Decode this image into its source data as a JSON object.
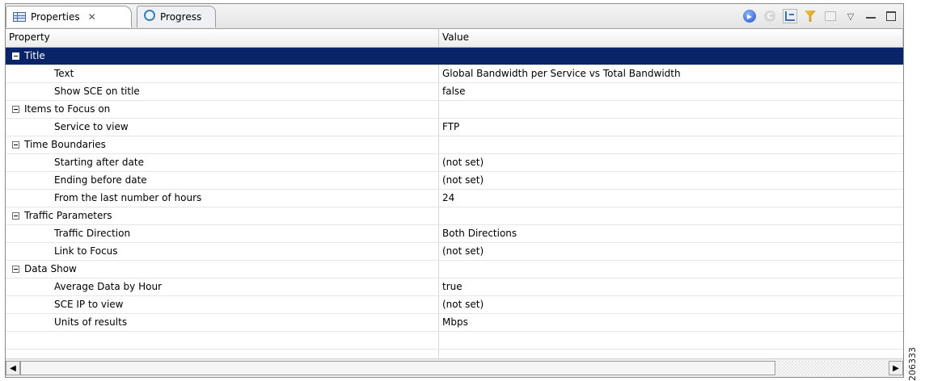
{
  "tabs": [
    {
      "label": "Properties",
      "icon": "properties-icon",
      "active": true,
      "close": "✕"
    },
    {
      "label": "Progress",
      "icon": "progress-icon",
      "active": false
    }
  ],
  "toolbar": {
    "icons": [
      "run-icon",
      "c-icon",
      "show-categories-icon",
      "filter-icon",
      "advanced-icon",
      "view-menu-icon",
      "minimize-icon",
      "maximize-icon"
    ],
    "menu_glyph": "▽",
    "c_glyph": "C"
  },
  "table": {
    "headers": {
      "property": "Property",
      "value": "Value"
    },
    "rows": [
      {
        "property": "Title",
        "value": "",
        "category": true,
        "selected": true
      },
      {
        "property": "Text",
        "value": "Global Bandwidth per Service vs Total Bandwidth"
      },
      {
        "property": "Show SCE on title",
        "value": "false"
      },
      {
        "property": "Items to Focus on",
        "value": "",
        "category": true
      },
      {
        "property": "Service to view",
        "value": "FTP"
      },
      {
        "property": "Time Boundaries",
        "value": "",
        "category": true
      },
      {
        "property": "Starting after date",
        "value": "(not set)"
      },
      {
        "property": "Ending before date",
        "value": "(not set)"
      },
      {
        "property": "From the last number of hours",
        "value": "24"
      },
      {
        "property": "Traffic Parameters",
        "value": "",
        "category": true
      },
      {
        "property": "Traffic Direction",
        "value": "Both Directions"
      },
      {
        "property": "Link to Focus",
        "value": "(not set)"
      },
      {
        "property": "Data Show",
        "value": "",
        "category": true
      },
      {
        "property": "Average Data by Hour",
        "value": "true"
      },
      {
        "property": "SCE IP to view",
        "value": "(not set)"
      },
      {
        "property": "Units of results",
        "value": "Mbps"
      },
      {
        "property": "",
        "value": ""
      },
      {
        "property": "",
        "value": ""
      }
    ]
  },
  "scrollbar": {
    "left_arrow": "◀",
    "right_arrow": "▶",
    "thumb_fraction": 0.87
  },
  "watermark": "206333",
  "colors": {
    "selection": "#0a246a",
    "border": "#8a8a8a"
  }
}
